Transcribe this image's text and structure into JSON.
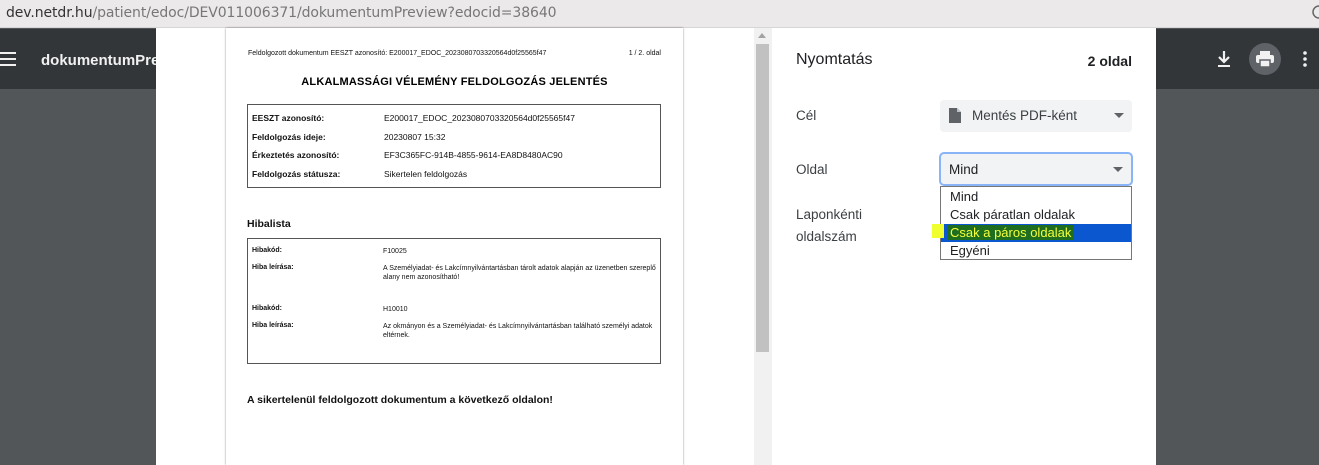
{
  "browser": {
    "url_host": "dev.netdr.hu",
    "url_path": "/patient/edoc/DEV011006371/dokumentumPreview?edocid=38640"
  },
  "viewer": {
    "title": "dokumentumPreview",
    "icons": [
      "menu-icon",
      "download-icon",
      "print-icon",
      "more-vert-icon"
    ]
  },
  "document": {
    "header_left": "Feldolgozott dokumentum EESZT azonosító: E200017_EDOC_2023080703320564d0f25565f47",
    "header_right": "1 / 2. oldal",
    "title": "ALKALMASSÁGI VÉLEMÉNY FELDOLGOZÁS JELENTÉS",
    "info_rows": [
      {
        "key": "EESZT azonosító:",
        "value": "E200017_EDOC_2023080703320564d0f25565f47"
      },
      {
        "key": "Feldolgozás ideje:",
        "value": "20230807 15:32"
      },
      {
        "key": "Érkeztetés azonosító:",
        "value": "EF3C365FC-914B-4855-9614-EA8D8480AC90"
      },
      {
        "key": "Feldolgozás státusza:",
        "value": "Sikertelen feldolgozás"
      }
    ],
    "error_section_title": "Hibalista",
    "errors": [
      {
        "code_label": "Hibakód:",
        "code": "F10025",
        "desc_label": "Hiba leírása:",
        "desc": "A Személyiadat- és Lakcímnyilvántartásban tárolt adatok alapján az üzenetben szereplő alany nem azonosítható!"
      },
      {
        "code_label": "Hibakód:",
        "code": "H10010",
        "desc_label": "Hiba leírása:",
        "desc": "Az okmányon és a Személyiadat- és Lakcímnyilvántartásban található személyi adatok eltérnek."
      }
    ],
    "footer_text": "A sikertelenül feldolgozott dokumentum a következő oldalon!"
  },
  "print_panel": {
    "title": "Nyomtatás",
    "page_count": "2 oldal",
    "destination_label": "Cél",
    "destination_value": "Mentés PDF-ként",
    "pages_label": "Oldal",
    "pages_value": "Mind",
    "pages_options": [
      "Mind",
      "Csak páratlan oldalak",
      "Csak a páros oldalak",
      "Egyéni"
    ],
    "pages_selected_index": 2,
    "per_sheet_label_line1": "Laponkénti",
    "per_sheet_label_line2": "oldalszám"
  }
}
